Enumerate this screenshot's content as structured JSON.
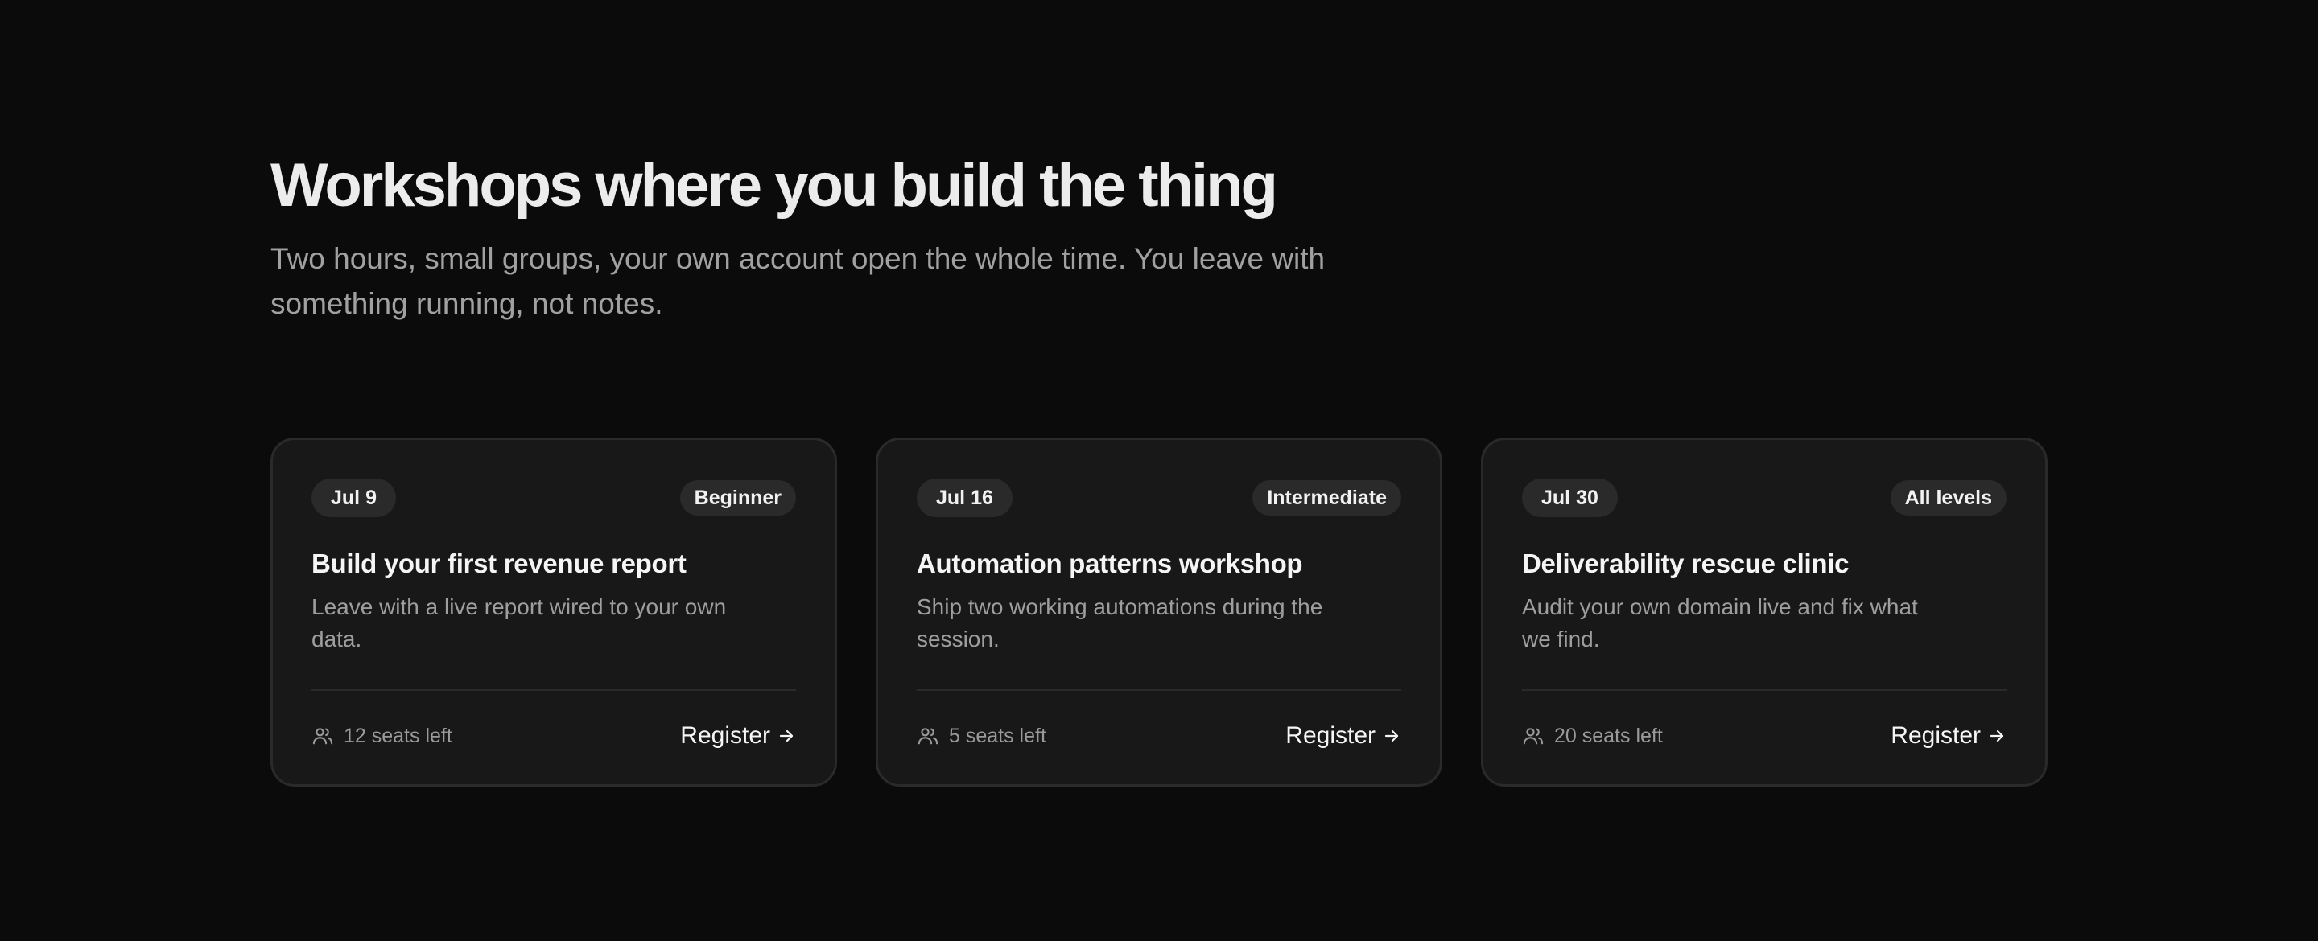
{
  "section": {
    "title": "Workshops where you build the thing",
    "subtitle": "Two hours, small groups, your own account open the whole time. You leave with something running, not notes."
  },
  "cards": [
    {
      "date": "Jul 9",
      "level": "Beginner",
      "title": "Build your first revenue report",
      "description": "Leave with a live report wired to your own data.",
      "seats": "12 seats left",
      "cta": "Register",
      "icons": {
        "seats": "users-icon",
        "cta": "arrow-right-icon"
      }
    },
    {
      "date": "Jul 16",
      "level": "Intermediate",
      "title": "Automation patterns workshop",
      "description": "Ship two working automations during the session.",
      "seats": "5 seats left",
      "cta": "Register",
      "icons": {
        "seats": "users-icon",
        "cta": "arrow-right-icon"
      }
    },
    {
      "date": "Jul 30",
      "level": "All levels",
      "title": "Deliverability rescue clinic",
      "description": "Audit your own domain live and fix what we find.",
      "seats": "20 seats left",
      "cta": "Register",
      "icons": {
        "seats": "users-icon",
        "cta": "arrow-right-icon"
      }
    }
  ],
  "colors": {
    "background": "#0b0b0b",
    "card": "#181818",
    "border": "#2a2a2a",
    "text": "#f5f5f5",
    "muted": "#9e9e9e"
  }
}
